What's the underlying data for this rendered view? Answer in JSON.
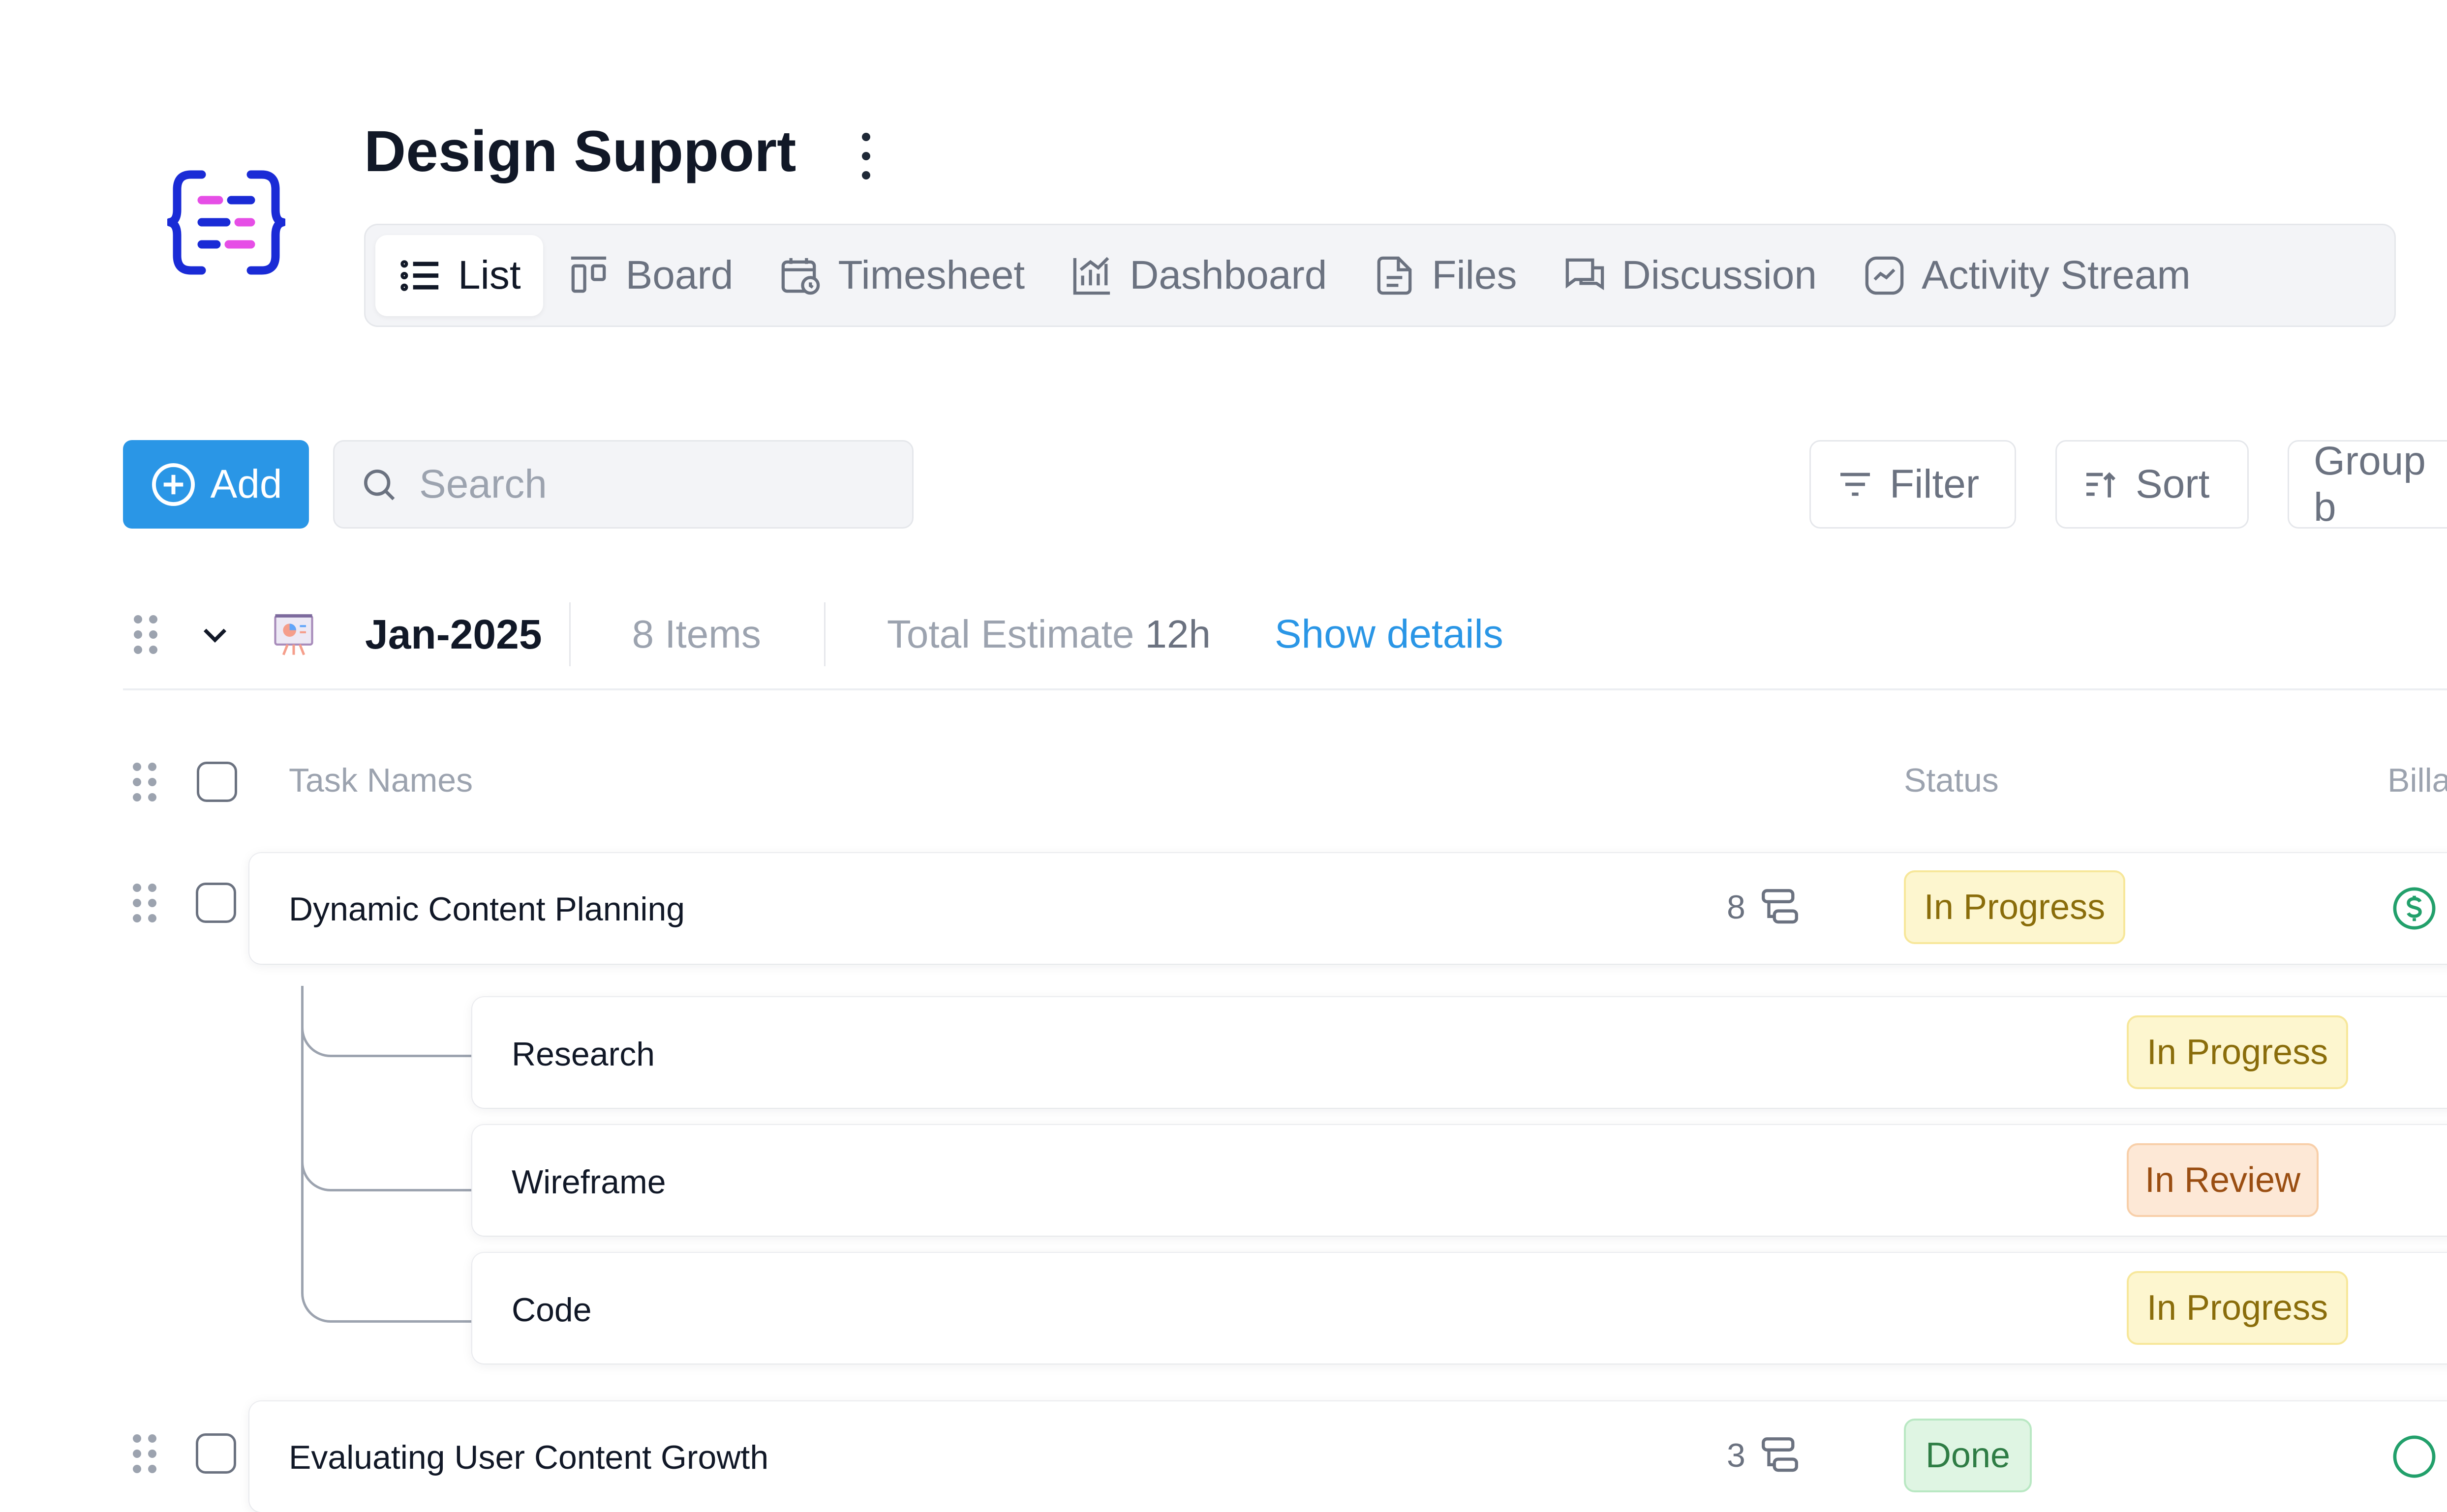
{
  "project": {
    "title": "Design Support",
    "logo_icon": "brackets-logo-icon"
  },
  "tabs": [
    {
      "label": "List",
      "icon": "list-icon",
      "active": true
    },
    {
      "label": "Board",
      "icon": "board-icon"
    },
    {
      "label": "Timesheet",
      "icon": "calendar-clock-icon"
    },
    {
      "label": "Dashboard",
      "icon": "chart-icon"
    },
    {
      "label": "Files",
      "icon": "file-icon"
    },
    {
      "label": "Discussion",
      "icon": "chat-icon"
    },
    {
      "label": "Activity Stream",
      "icon": "activity-icon"
    }
  ],
  "toolbar": {
    "add_label": "Add",
    "search_placeholder": "Search",
    "filter_label": "Filter",
    "sort_label": "Sort",
    "group_label": "Group b"
  },
  "group": {
    "name": "Jan-2025",
    "items_count": "8 Items",
    "estimate_label": "Total Estimate",
    "estimate_value": "12h",
    "show_details": "Show details"
  },
  "columns": {
    "task_names": "Task Names",
    "status": "Status",
    "billable": "Billa"
  },
  "tasks": [
    {
      "name": "Dynamic Content Planning",
      "subtask_count": "8",
      "status": "In Progress",
      "subtasks": [
        {
          "name": "Research",
          "status": "In Progress"
        },
        {
          "name": "Wireframe",
          "status": "In Review"
        },
        {
          "name": "Code",
          "status": "In Progress"
        }
      ]
    },
    {
      "name": "Evaluating User Content Growth",
      "subtask_count": "3",
      "status": "Done"
    }
  ],
  "colors": {
    "accent": "#2a96e6",
    "link": "#2a96e6",
    "billable": "#22a06b"
  }
}
